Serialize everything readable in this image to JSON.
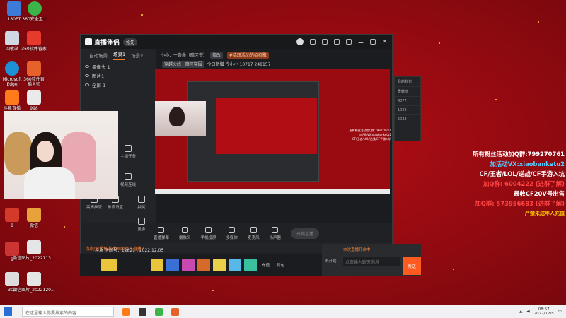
{
  "desktop": {
    "icons": [
      {
        "label": "180ET",
        "color": "#3c7bd8"
      },
      {
        "label": "360安全卫士",
        "color": "#3bb54a"
      },
      {
        "label": "回收站",
        "color": "#cfd8e3"
      },
      {
        "label": "360软件管家",
        "color": "#e53a2c"
      },
      {
        "label": "Microsoft Edge",
        "color": "#1e90d6"
      },
      {
        "label": "360软件直播大师",
        "color": "#e6622a"
      },
      {
        "label": "斗鱼直播",
        "color": "#ff7a1a"
      },
      {
        "label": "998",
        "color": "#eaeaea"
      },
      {
        "label": "8",
        "color": "#d43a2a"
      },
      {
        "label": "微信",
        "color": "#eaeaea"
      },
      {
        "label": "9",
        "color": "#cc3333"
      },
      {
        "label": "微信图片_2022113...",
        "color": "#e5e5e5"
      },
      {
        "label": "302",
        "color": "#dddddd"
      },
      {
        "label": "微信图片_2022120...",
        "color": "#e5e5e5"
      }
    ]
  },
  "app": {
    "name": "直播伴侣",
    "version_badge": "抢先",
    "tabs": [
      "自动场景",
      "场景1",
      "场景2"
    ],
    "scenes": [
      "摄像头 1",
      "图片1",
      "全屏 1"
    ],
    "room": {
      "title": "小小：一条命（暗区查）",
      "tag_edit": "修改",
      "tag_activity": "#活跃活动的招招聚",
      "category": "穿越火线 · 暗区突围",
      "fans_label": "今日新增 今小小",
      "fans_count": "10717",
      "viewers": "248157"
    },
    "tools": [
      {
        "label": "直播弹幕",
        "icon": "barrage-icon"
      },
      {
        "label": "摄像头",
        "icon": "camera-icon"
      },
      {
        "label": "手机投屏",
        "icon": "phone-cast-icon"
      },
      {
        "label": "多媒体",
        "icon": "media-icon"
      },
      {
        "label": "麦克风",
        "icon": "mic-icon"
      },
      {
        "label": "扬声器",
        "icon": "speaker-icon"
      }
    ],
    "left_tools": [
      {
        "label": "主播任务"
      },
      {
        "label": "视频连线"
      },
      {
        "label": "高清推流"
      },
      {
        "label": "推流设置"
      },
      {
        "label": "抽奖"
      },
      {
        "label": "更多"
      }
    ],
    "start_button": "开始直播",
    "notice": "如何把手机游戏画面接入直播？",
    "info_line": "斗鱼 房间号：12821 | 2022.12.05",
    "side_panel": [
      "我的背包",
      "贡献榜",
      "4077",
      "1022",
      "5033"
    ],
    "gifts": [
      {
        "color": "#e8c53a"
      },
      {
        "color": "#3a6fd6"
      },
      {
        "color": "#c84ab0"
      },
      {
        "color": "#d66a2a"
      },
      {
        "color": "#e8d04a"
      },
      {
        "color": "#58b8e8"
      },
      {
        "color": "#3ac0a0"
      }
    ],
    "gift_labels": [
      "充值",
      "背包"
    ],
    "chat_placeholder": "点击输入聊天消息",
    "send_label": "发送",
    "chat_notice": "本次直播开启中",
    "live_tag": "未开始"
  },
  "promo": {
    "lines": [
      "所有粉丝活动加Q群:799270761",
      "加活动VX:xiaobanketu2",
      "CF/王者/LOL/逆战/CF手游入坑",
      "加Q群: 6004222 (进群了解)",
      "最收CF20V号出售",
      "加Q群: 573956683 (进群了解)",
      "严禁未成年人充值"
    ]
  },
  "taskbar": {
    "search_placeholder": "在这里输入你要搜索的内容",
    "apps": [
      {
        "color": "#ff7a1a"
      },
      {
        "color": "#333333"
      },
      {
        "color": "#3bb54a"
      },
      {
        "color": "#e6622a"
      }
    ],
    "time": "08:57",
    "date": "2022/12/5"
  },
  "colors": {
    "accent": "#ff5a1f",
    "desktop_red": "#a30c12"
  }
}
